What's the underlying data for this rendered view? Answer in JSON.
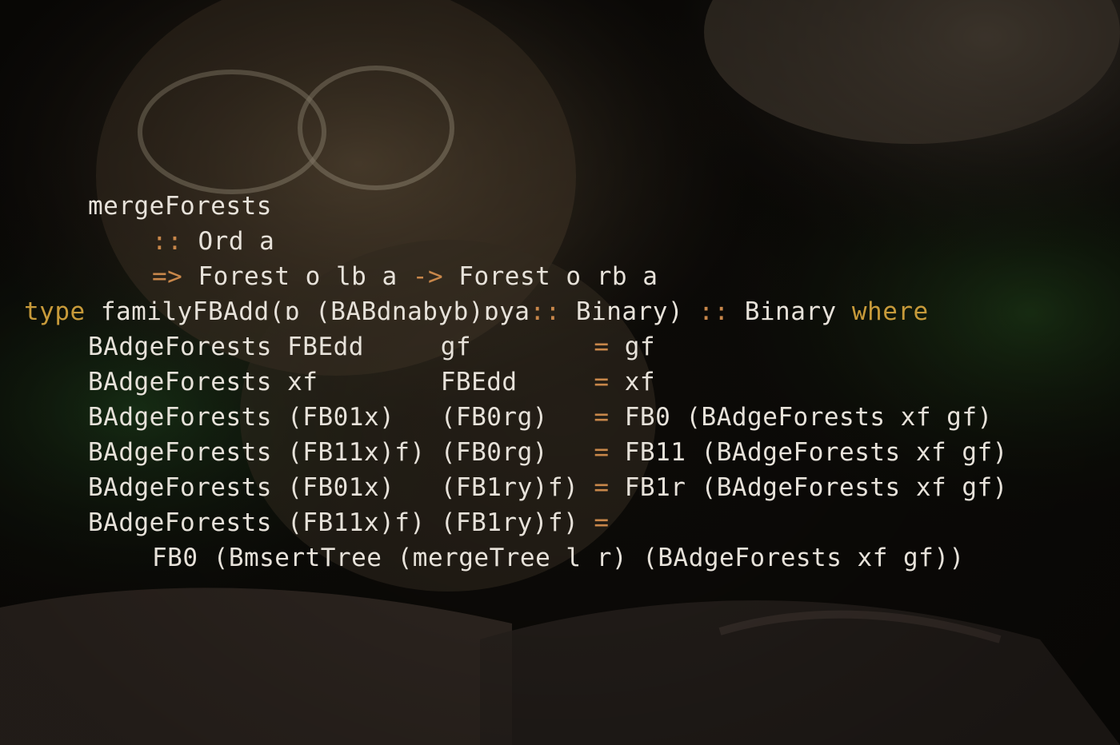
{
  "code_lines": [
    {
      "indent": "  ",
      "text": "mergeForests",
      "overlay": ""
    },
    {
      "indent": "    ",
      "prefix": ":: ",
      "text": "Ord a",
      "overlay": ""
    },
    {
      "indent": "    ",
      "prefix": "=> ",
      "text": "Forest o lb a ",
      "arrow": "->",
      "text2": " Forest o rb a",
      "overlay": ""
    },
    {
      "indent": "",
      "keyword": "type",
      "text": " familyFBAdd(ɒ (BABdnabyb)ɒya",
      "op": ":: ",
      "text2": "Binary) ",
      "op2": ":: ",
      "text3": "Binary ",
      "keyword2": "where",
      "overlay": ""
    },
    {
      "indent": "  ",
      "text": "BAdgeForests FBEdd     gf        ",
      "op": "=",
      "text2": " gf",
      "overlay": ""
    },
    {
      "indent": "  ",
      "text": "BAdgeForests xf        FBEdd     ",
      "op": "=",
      "text2": " xf",
      "overlay": ""
    },
    {
      "indent": "  ",
      "text": "BAdgeForests (FB01x)   (FB0rg)   ",
      "op": "=",
      "text2": " FB0 (BAdgeForests xf gf)",
      "overlay": ""
    },
    {
      "indent": "  ",
      "text": "BAdgeForests (FB11x)f) (FB0rg)   ",
      "op": "=",
      "text2": " FB11 (BAdgeForests xf gf)",
      "overlay": ""
    },
    {
      "indent": "  ",
      "text": "BAdgeForests (FB01x)   (FB1ry)f) ",
      "op": "=",
      "text2": " FB1r (BAdgeForests xf gf)",
      "overlay": ""
    },
    {
      "indent": "  ",
      "text": "BAdgeForests (FB11x)f) (FB1ry)f) ",
      "op": "=",
      "text2": "",
      "overlay": ""
    },
    {
      "indent": "    ",
      "text": "FB0 (BmsertTree (mergeTree l r) (BAdgeForests xf gf))",
      "overlay": ""
    }
  ],
  "colors": {
    "text": "#e7e2da",
    "operator": "#c8874a",
    "keyword": "#c79a3a",
    "background": "#0d0b08"
  }
}
